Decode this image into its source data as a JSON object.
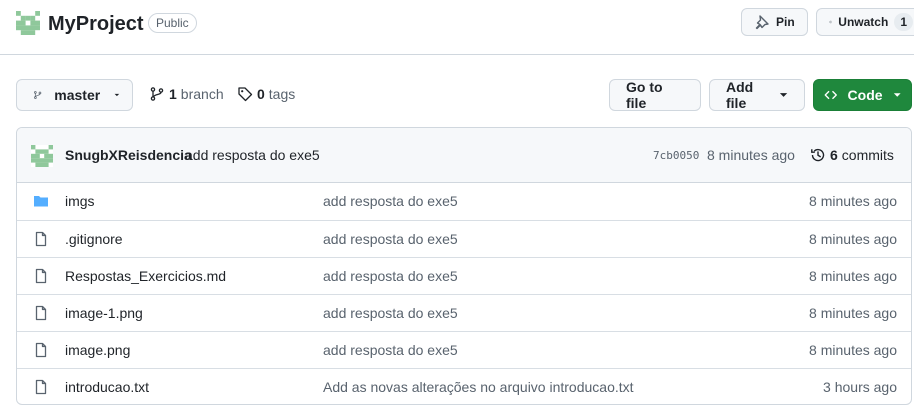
{
  "header": {
    "repo_name": "MyProject",
    "visibility": "Public",
    "pin_label": "Pin",
    "watch_label": "Unwatch",
    "watch_count": "1"
  },
  "toolbar": {
    "branch_name": "master",
    "branch_count": "1",
    "branch_label": "branch",
    "tag_count": "0",
    "tag_label": "tags",
    "goto_label": "Go to file",
    "addfile_label": "Add file",
    "code_label": "Code"
  },
  "latest_commit": {
    "author": "SnugbXReisdencia",
    "message": "add resposta do exe5",
    "sha": "7cb0050",
    "time": "8 minutes ago",
    "commit_count": "6",
    "commits_label": "commits"
  },
  "files": [
    {
      "name": "imgs",
      "type": "folder",
      "message": "add resposta do exe5",
      "time": "8 minutes ago"
    },
    {
      "name": ".gitignore",
      "type": "file",
      "message": "add resposta do exe5",
      "time": "8 minutes ago"
    },
    {
      "name": "Respostas_Exercicios.md",
      "type": "file",
      "message": "add resposta do exe5",
      "time": "8 minutes ago"
    },
    {
      "name": "image-1.png",
      "type": "file",
      "message": "add resposta do exe5",
      "time": "8 minutes ago"
    },
    {
      "name": "image.png",
      "type": "file",
      "message": "add resposta do exe5",
      "time": "8 minutes ago"
    },
    {
      "name": "introducao.txt",
      "type": "file",
      "message": "Add as novas alterações no arquivo introducao.txt",
      "time": "3 hours ago"
    }
  ],
  "colors": {
    "accent_green": "#1f883d",
    "folder_blue": "#54aeff",
    "avatar_green": "#8fc89b"
  }
}
